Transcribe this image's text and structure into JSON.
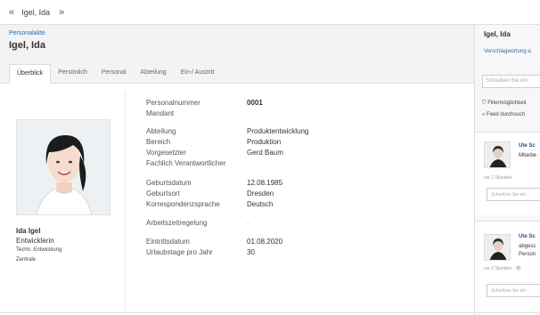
{
  "topbar": {
    "back_icon": "«",
    "forward_icon": "»",
    "title": "Igel, Ida"
  },
  "header": {
    "breadcrumb": "Personalakte",
    "name": "Igel, Ida",
    "tabs": [
      "Überblick",
      "Persönlich",
      "Personal",
      "Abteilung",
      "Ein-/ Austritt"
    ]
  },
  "profile": {
    "name": "Ida Igel",
    "role": "Entwicklerin",
    "department": "Techn. Entwicklung",
    "location": "Zentrale"
  },
  "fields": [
    {
      "label": "Personalnummer",
      "value": "0001"
    },
    {
      "label": "Mandant",
      "value": "-"
    },
    {
      "label": "Abteilung",
      "value": "Produktentwicklung"
    },
    {
      "label": "Bereich",
      "value": "Produktion"
    },
    {
      "label": "Vorgesetzter",
      "value": "Gerd Baum"
    },
    {
      "label": "Fachlich Verantwortlicher",
      "value": "-"
    },
    {
      "label": "Geburtsdatum",
      "value": "12.08.1985"
    },
    {
      "label": "Geburtsort",
      "value": "Dresden"
    },
    {
      "label": "Korrespondenzsprache",
      "value": "Deutsch"
    },
    {
      "label": "Arbeitszeitregelung",
      "value": "-"
    },
    {
      "label": "Eintrittsdatum",
      "value": "01.08.2020"
    },
    {
      "label": "Urlaubstage pro Jahr",
      "value": "30"
    }
  ],
  "sidebar": {
    "title": "Igel, Ida",
    "link": "Verschlagwortung a",
    "input_placeholder": "Schreiben Sie ein",
    "filter": "Filtermöglichkeit",
    "search": "Feed durchsuch",
    "posts": [
      {
        "author": "Ute Sc",
        "text": [
          "Mitarbe"
        ],
        "time": "vor 2 Stunden",
        "reply_placeholder": "Schreiben Sie ein"
      },
      {
        "author": "Ute Sc",
        "text": [
          "abgesc",
          "Person"
        ],
        "time": "vor 2 Stunden · 👁",
        "reply_placeholder": "Schreiben Sie ein"
      }
    ]
  },
  "colors": {
    "link": "#1f6fb2",
    "header_bg": "#f3f3f3",
    "sidebar_bg": "#f7f7f7"
  }
}
